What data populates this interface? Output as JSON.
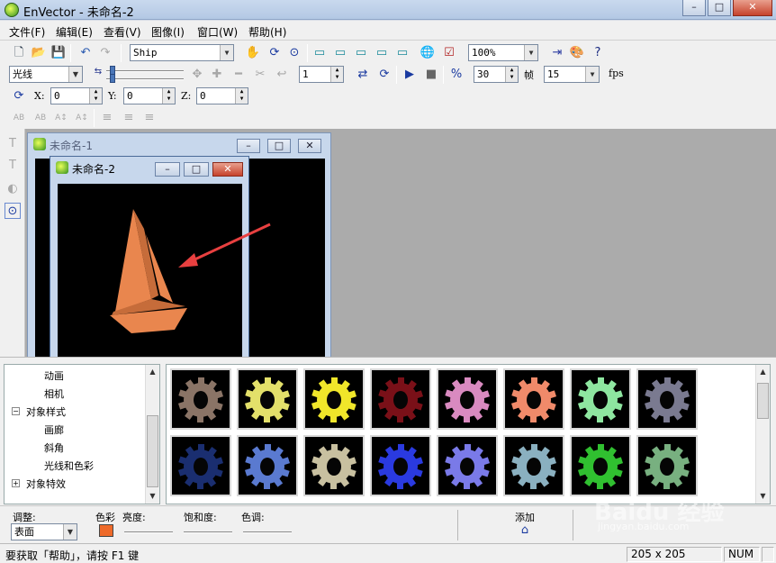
{
  "window": {
    "title": "EnVector - 未命名-2",
    "min_label": "–",
    "max_label": "□",
    "close_label": "✕"
  },
  "menu": [
    "文件(F)",
    "编辑(E)",
    "查看(V)",
    "图像(I)",
    "窗口(W)",
    "帮助(H)"
  ],
  "toolbar": {
    "object_name": "Ship",
    "zoom": "100%",
    "mode": "光线",
    "frame_start": "1",
    "frame_count": "30",
    "frame_label": "帧",
    "fps": "15",
    "fps_label": "fps"
  },
  "coords": {
    "x_label": "X:",
    "x": "0",
    "y_label": "Y:",
    "y": "0",
    "z_label": "Z:",
    "z": "0"
  },
  "documents": [
    {
      "title": "未命名-1",
      "min_label": "–",
      "max_label": "□",
      "close_label": "✕"
    },
    {
      "title": "未命名-2",
      "min_label": "–",
      "max_label": "□",
      "close_label": "✕"
    }
  ],
  "tree": [
    {
      "label": "动画",
      "level": 2
    },
    {
      "label": "相机",
      "level": 2
    },
    {
      "label": "对象样式",
      "level": 1,
      "expander": "−"
    },
    {
      "label": "画廊",
      "level": 2
    },
    {
      "label": "斜角",
      "level": 2
    },
    {
      "label": "光线和色彩",
      "level": 2
    },
    {
      "label": "对象特效",
      "level": 1,
      "expander": "+"
    }
  ],
  "gallery": {
    "row1_colors": [
      "#8a7466",
      "#e3e06a",
      "#f0e62a",
      "#7a1018",
      "#d98ac0",
      "#f08a6a",
      "#8ee6a0",
      "#7a7a90"
    ],
    "row2_colors": [
      "#1a2e70",
      "#5a7ad0",
      "#c8c0a0",
      "#2a3ae0",
      "#7a7ae8",
      "#8ab0c0",
      "#30c030",
      "#78b080"
    ]
  },
  "adjust": {
    "adjust_label": "调整:",
    "surface_value": "表面",
    "color_label": "色彩",
    "color_swatch": "#ee6a2a",
    "brightness_label": "亮度:",
    "saturation_label": "饱和度:",
    "hue_label": "色调:",
    "add_label": "添加"
  },
  "status": {
    "message": "要获取「帮助」，请按 F1 键",
    "dimensions": "205 x 205",
    "num": "NUM"
  },
  "colors": {
    "sail": "#e9864e",
    "sail_shadow": "#c66c3a",
    "arrow": "#e84040"
  },
  "watermark": "Baidu 经验 jingyan.baidu.com"
}
